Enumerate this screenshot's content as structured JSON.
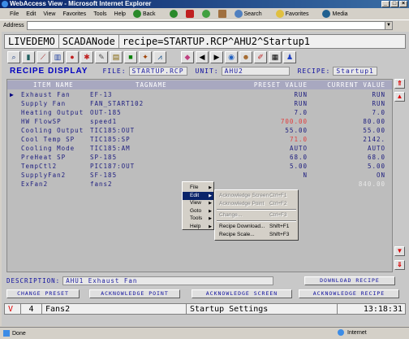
{
  "window": {
    "title": "WebAccess View - Microsoft Internet Explorer"
  },
  "menu": {
    "items": [
      "File",
      "Edit",
      "View",
      "Favorites",
      "Tools",
      "Help"
    ],
    "back_label": "Back",
    "search_label": "Search",
    "favorites_label": "Favorites",
    "media_label": "Media"
  },
  "address": {
    "label": "Address",
    "value": ""
  },
  "header": {
    "project": "LIVEDEMO",
    "node": "SCADANode",
    "recipe_path": "recipe=STARTUP.RCP^AHU2^Startup1"
  },
  "recipe_bar": {
    "title": "RECIPE DISPLAY",
    "file_label": "FILE:",
    "file_value": "STARTUP.RCP",
    "unit_label": "UNIT:",
    "unit_value": "AHU2",
    "recipe_label": "RECIPE:",
    "recipe_value": "Startup1"
  },
  "table": {
    "headers": {
      "item": "ITEM NAME",
      "tag": "TAGNAME",
      "preset": "PRESET VALUE",
      "current": "CURRENT VALUE"
    },
    "rows": [
      {
        "item": "Exhaust Fan",
        "tag": "EF-13",
        "preset": "RUN",
        "current": "RUN",
        "preset_color": "normal",
        "current_color": "normal",
        "selected": true
      },
      {
        "item": "Supply Fan",
        "tag": "FAN_START102",
        "preset": "RUN",
        "current": "RUN",
        "preset_color": "normal",
        "current_color": "normal"
      },
      {
        "item": "Heating Output",
        "tag": "OUT-185",
        "preset": "7.0",
        "current": "7.0",
        "preset_color": "normal",
        "current_color": "normal"
      },
      {
        "item": "HW FlowSP",
        "tag": "speed1",
        "preset": "700.00",
        "current": "80.00",
        "preset_color": "red",
        "current_color": "normal"
      },
      {
        "item": "Cooling Output",
        "tag": "TIC185:OUT",
        "preset": "55.00",
        "current": "55.00",
        "preset_color": "normal",
        "current_color": "normal"
      },
      {
        "item": "Cool Temp SP",
        "tag": "TIC185:SP",
        "preset": "71.0",
        "current": "2142.",
        "preset_color": "red",
        "current_color": "normal"
      },
      {
        "item": "Cooling Mode",
        "tag": "TIC185:AM",
        "preset": "AUTO",
        "current": "AUTO",
        "preset_color": "normal",
        "current_color": "normal"
      },
      {
        "item": "PreHeat SP",
        "tag": "SP-185",
        "preset": "68.0",
        "current": "68.0",
        "preset_color": "normal",
        "current_color": "normal"
      },
      {
        "item": "TempCtl2",
        "tag": "PIC187:OUT",
        "preset": "5.00",
        "current": "5.00",
        "preset_color": "normal",
        "current_color": "normal"
      },
      {
        "item": "SupplyFan2",
        "tag": "SF-185",
        "preset": "N",
        "current": "ON",
        "preset_color": "normal",
        "current_color": "normal"
      },
      {
        "item": "ExFan2",
        "tag": "fans2",
        "preset": "",
        "current": "840.00",
        "preset_color": "normal",
        "current_color": "gray"
      }
    ]
  },
  "description": {
    "label": "DESCRIPTION:",
    "value": "AHU1 Exhaust Fan"
  },
  "buttons": {
    "download": "DOWNLOAD RECIPE",
    "change_preset": "CHANGE PRESET",
    "ack_point": "ACKNOWLEDGE POINT",
    "ack_screen": "ACKNOWLEDGE SCREEN",
    "ack_recipe": "ACKNOWLEDGE RECIPE"
  },
  "status": {
    "flag": "V",
    "number": "4",
    "point": "Fans2",
    "screen": "Startup Settings",
    "time": "13:18:31"
  },
  "ie_status": {
    "left": "Done",
    "zone": "Internet"
  },
  "context_menu": {
    "items": [
      {
        "label": "File",
        "submenu": true
      },
      {
        "label": "Edit",
        "submenu": true,
        "active": true
      },
      {
        "label": "View",
        "submenu": true
      },
      {
        "label": "Goto",
        "submenu": true
      },
      {
        "label": "Tools",
        "submenu": true
      },
      {
        "label": "Help",
        "submenu": true
      }
    ],
    "submenu": [
      {
        "label": "Acknowledge Screen",
        "shortcut": "Ctrl+F1",
        "disabled": true
      },
      {
        "label": "Acknowledge Point",
        "shortcut": "Ctrl+F2",
        "disabled": true
      },
      {
        "label": "Change...",
        "shortcut": "Ctrl+F3",
        "disabled": true
      },
      {
        "label": "Recipe Download...",
        "shortcut": "Shift+F1",
        "disabled": false
      },
      {
        "label": "Recipe Scale...",
        "shortcut": "Shift+F3",
        "disabled": false
      }
    ]
  },
  "colors": {
    "accent_blue": "#0000c0",
    "alarm_red": "#e04040",
    "title_bar": "#0a246a"
  }
}
